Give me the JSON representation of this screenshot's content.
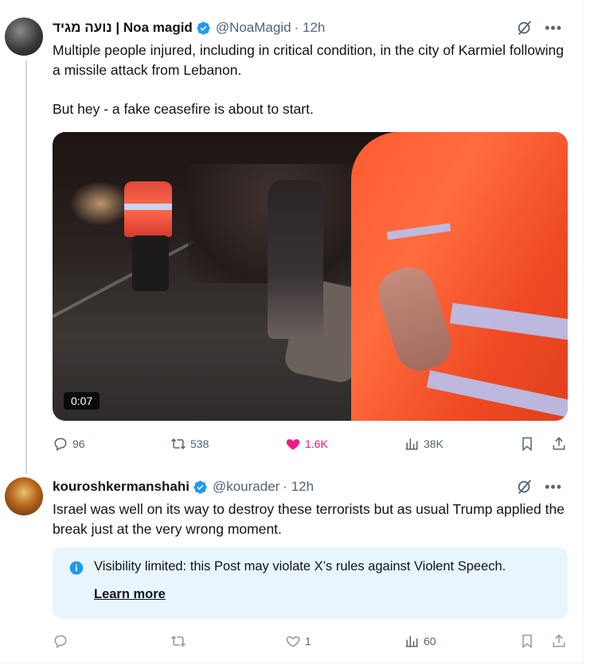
{
  "tweet1": {
    "display_name": "נועה מגיד | Noa magid",
    "handle": "@NoaMagid",
    "time": "· 12h",
    "text": "Multiple people injured, including in critical condition, in the city of Karmiel following a missile attack from Lebanon.\n\nBut hey - a fake ceasefire is about to start.",
    "video_duration": "0:07",
    "stats": {
      "replies": "96",
      "reposts": "538",
      "likes": "1.6K",
      "views": "38K"
    },
    "liked": true
  },
  "tweet2": {
    "display_name": "kouroshkermanshahi",
    "handle": "@kourader",
    "time": "· 12h",
    "text": "Israel was well on its way to destroy these terrorists but as usual Trump applied the break just at the very wrong moment.",
    "notice": {
      "text": "Visibility limited: this Post may violate X’s rules against Violent Speech.",
      "link": "Learn more"
    },
    "stats": {
      "replies": "",
      "reposts": "",
      "likes": "1",
      "views": "60"
    }
  },
  "colors": {
    "accent": "#1d9bf0",
    "like": "#f91880",
    "muted": "#536471",
    "notice_bg": "#e8f5fd"
  },
  "icons": [
    "verified-badge-icon",
    "grok-icon",
    "more-icon",
    "reply-icon",
    "repost-icon",
    "heart-icon",
    "views-icon",
    "bookmark-icon",
    "share-icon",
    "info-icon"
  ]
}
